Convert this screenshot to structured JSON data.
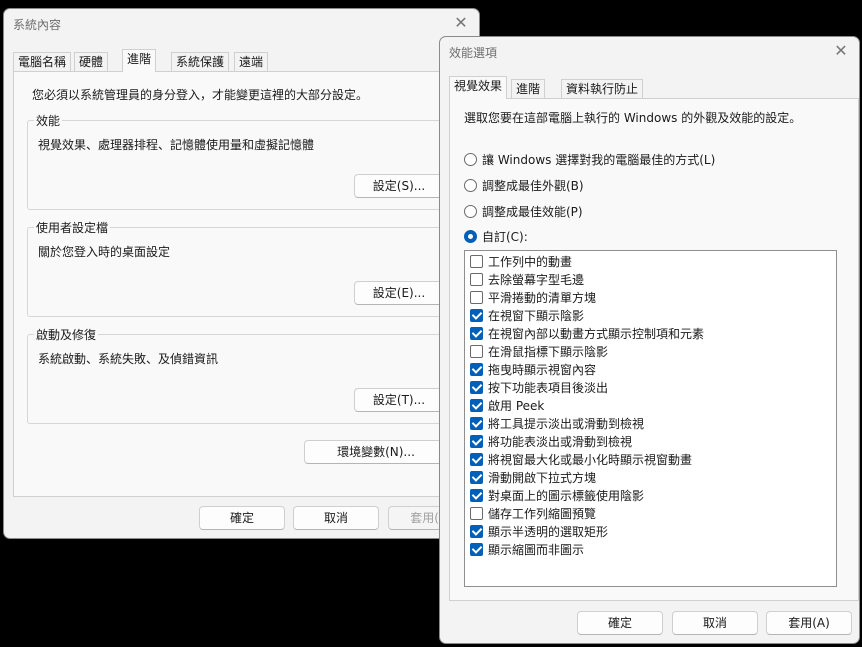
{
  "sysprops": {
    "title": "系統內容",
    "tabs": [
      "電腦名稱",
      "硬體",
      "進階",
      "系統保護",
      "遠端"
    ],
    "admin_note": "您必須以系統管理員的身分登入，才能變更這裡的大部分設定。",
    "performance": {
      "title": "效能",
      "desc": "視覺效果、處理器排程、記憶體使用量和虛擬記憶體",
      "button": "設定(S)..."
    },
    "profiles": {
      "title": "使用者設定檔",
      "desc": "關於您登入時的桌面設定",
      "button": "設定(E)..."
    },
    "startup": {
      "title": "啟動及修復",
      "desc": "系統啟動、系統失敗、及偵錯資訊",
      "button": "設定(T)..."
    },
    "env_button": "環境變數(N)...",
    "ok": "確定",
    "cancel": "取消",
    "apply": "套用(A)"
  },
  "perfopts": {
    "title": "效能選項",
    "tabs": [
      "視覺效果",
      "進階",
      "資料執行防止"
    ],
    "intro": "選取您要在這部電腦上執行的 Windows 的外觀及效能的設定。",
    "radios": [
      {
        "label": "讓 Windows 選擇對我的電腦最佳的方式(L)",
        "selected": false
      },
      {
        "label": "調整成最佳外觀(B)",
        "selected": false
      },
      {
        "label": "調整成最佳效能(P)",
        "selected": false
      },
      {
        "label": "自訂(C):",
        "selected": true
      }
    ],
    "options": [
      {
        "label": "工作列中的動畫",
        "checked": false
      },
      {
        "label": "去除螢幕字型毛邊",
        "checked": false
      },
      {
        "label": "平滑捲動的清單方塊",
        "checked": false
      },
      {
        "label": "在視窗下顯示陰影",
        "checked": true
      },
      {
        "label": "在視窗內部以動畫方式顯示控制項和元素",
        "checked": true
      },
      {
        "label": "在滑鼠指標下顯示陰影",
        "checked": false
      },
      {
        "label": "拖曳時顯示視窗內容",
        "checked": true
      },
      {
        "label": "按下功能表項目後淡出",
        "checked": true
      },
      {
        "label": "啟用 Peek",
        "checked": true
      },
      {
        "label": "將工具提示淡出或滑動到檢視",
        "checked": true
      },
      {
        "label": "將功能表淡出或滑動到檢視",
        "checked": true
      },
      {
        "label": "將視窗最大化或最小化時顯示視窗動畫",
        "checked": true
      },
      {
        "label": "滑動開啟下拉式方塊",
        "checked": true
      },
      {
        "label": "對桌面上的圖示標籤使用陰影",
        "checked": true
      },
      {
        "label": "儲存工作列縮圖預覽",
        "checked": false
      },
      {
        "label": "顯示半透明的選取矩形",
        "checked": true
      },
      {
        "label": "顯示縮圖而非圖示",
        "checked": true
      }
    ],
    "ok": "確定",
    "cancel": "取消",
    "apply": "套用(A)"
  }
}
